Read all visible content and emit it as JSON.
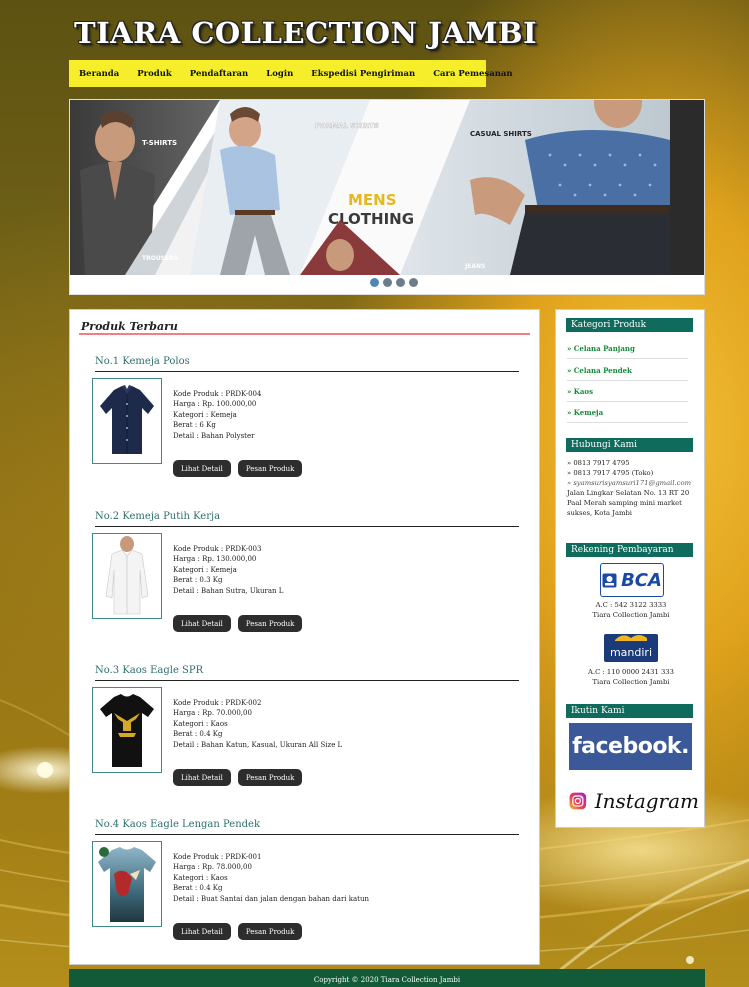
{
  "site": {
    "title": "TIARA COLLECTION JAMBI"
  },
  "nav": {
    "items": [
      {
        "label": "Beranda"
      },
      {
        "label": "Produk"
      },
      {
        "label": "Pendaftaran"
      },
      {
        "label": "Login"
      },
      {
        "label": "Ekspedisi Pengiriman"
      },
      {
        "label": "Cara Pemesanan"
      }
    ]
  },
  "banner": {
    "labels": {
      "tshirts": "T-SHIRTS",
      "formal": "FORMAL SHIRTS",
      "casual": "CASUAL SHIRTS",
      "mens": "MENS",
      "clothing": "CLOTHING",
      "trousers": "TROUSERS",
      "jeans": "JEANS"
    },
    "slides": 4,
    "active_slide": 1
  },
  "main": {
    "section_title": "Produk Terbaru",
    "detail_button": "Lihat Detail",
    "order_button": "Pesan Produk",
    "products": [
      {
        "name": "No.1 Kemeja Polos",
        "code": "Kode Produk : PRDK-004",
        "price": "Harga : Rp. 100.000,00",
        "category": "Kategori : Kemeja",
        "weight": "Berat : 6 Kg",
        "detail": "Detail : Bahan Polyster",
        "image": "navy-shirt"
      },
      {
        "name": "No.2 Kemeja Putih Kerja",
        "code": "Kode Produk : PRDK-003",
        "price": "Harga : Rp. 130.000,00",
        "category": "Kategori : Kemeja",
        "weight": "Berat : 0.3 Kg",
        "detail": "Detail : Bahan Sutra, Ukuran L",
        "image": "white-shirt"
      },
      {
        "name": "No.3 Kaos Eagle SPR",
        "code": "Kode Produk : PRDK-002",
        "price": "Harga : Rp. 70.000,00",
        "category": "Kategori : Kaos",
        "weight": "Berat : 0.4 Kg",
        "detail": "Detail : Bahan Katun, Kasual, Ukuran All Size L",
        "image": "black-eagle-tshirt"
      },
      {
        "name": "No.4 Kaos Eagle Lengan Pendek",
        "code": "Kode Produk : PRDK-001",
        "price": "Harga : Rp. 78.000,00",
        "category": "Kategori : Kaos",
        "weight": "Berat : 0.4 Kg",
        "detail": "Detail : Buat Santai dan jalan dengan bahan dari katun",
        "image": "printed-eagle-tshirt"
      }
    ]
  },
  "sidebar": {
    "categories_title": "Kategori Produk",
    "categories": [
      {
        "label": "» Celana Panjang"
      },
      {
        "label": "» Celana Pendek"
      },
      {
        "label": "» Kaos"
      },
      {
        "label": "» Kemeja"
      }
    ],
    "contact_title": "Hubungi Kami",
    "contact_lines": [
      "» 0813 7917 4795",
      "» 0813 7917 4795 (Toko)",
      "» syamsurisyamsuri171@gmail.com",
      "Jalan Lingkar Selatan No. 13 RT 20 Paal Merah samping mini market sukses, Kota Jambi"
    ],
    "bank_title": "Rekening Pembayaran",
    "banks": [
      {
        "logo_text": "BCA",
        "account": "A.C : 542 3122 3333",
        "holder": "Tiara Collection Jambi"
      },
      {
        "logo_text": "mandiri",
        "account": "A.C : 110 0000 2431 333",
        "holder": "Tiara Collection Jambi"
      }
    ],
    "follow_title": "Ikutin Kami",
    "facebook_text": "facebook.",
    "instagram_text": "Instagram"
  },
  "footer": {
    "text": "Copyright © 2020 Tiara Collection Jambi"
  },
  "colors": {
    "nav_bg": "#f6ee2a",
    "sidebar_head": "#0f6b5c",
    "footer_bg": "#125a38",
    "title_underline": "#f08080",
    "product_name": "#2d6f6b",
    "category_link": "#178a3a",
    "facebook": "#3b5998"
  }
}
